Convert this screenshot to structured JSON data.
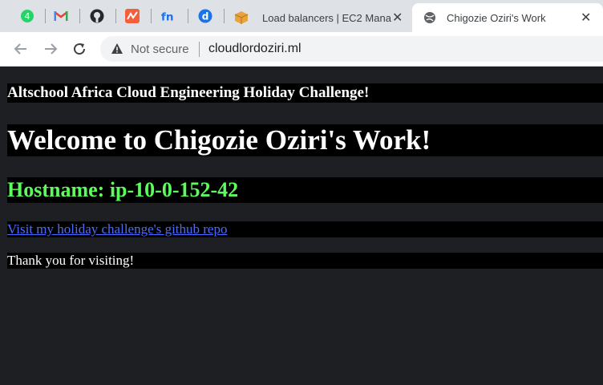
{
  "tabs": {
    "pinned": [
      {
        "icon": "whatsapp-icon",
        "color": "#25d366"
      },
      {
        "icon": "gmail-icon",
        "color": "#ea4335"
      },
      {
        "icon": "github-icon",
        "color": "#24292e"
      },
      {
        "icon": "netlify-icon",
        "color": "#f55e3a"
      },
      {
        "icon": "fn-icon",
        "color": "#1a73e8"
      },
      {
        "icon": "d-icon",
        "color": "#1a73e8"
      }
    ],
    "items": [
      {
        "title": "Load balancers | EC2 Mana",
        "icon": "aws-box-icon",
        "active": false
      },
      {
        "title": "Chigozie Oziri's Work",
        "icon": "globe-icon",
        "active": true
      }
    ],
    "close_glyph": "✕"
  },
  "toolbar": {
    "security_label": "Not secure",
    "url": "cloudlordoziri.ml"
  },
  "page": {
    "subheading": "Altschool Africa Cloud Engineering Holiday Challenge!",
    "heading": "Welcome to Chigozie Oziri's Work!",
    "hostname": "Hostname: ip-10-0-152-42",
    "link_text": "Visit my holiday challenge's github repo",
    "thanks": "Thank you for visiting!"
  },
  "colors": {
    "page_bg": "#1e1f22",
    "block_bg": "#000000",
    "hostname_green": "#5dfc5d",
    "link_blue": "#4b6dff"
  }
}
